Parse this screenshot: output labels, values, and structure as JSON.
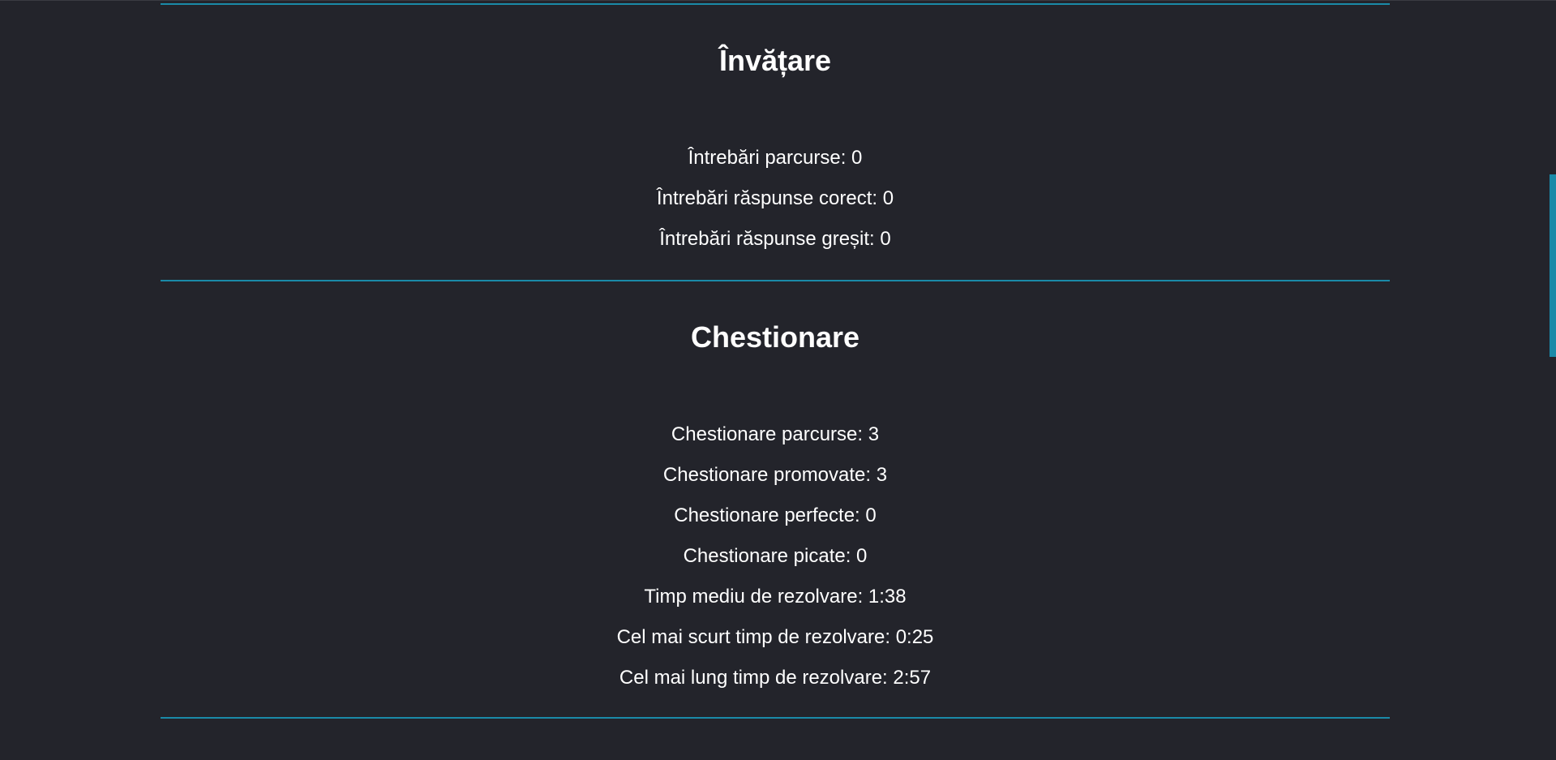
{
  "sections": [
    {
      "title": "Învățare",
      "stats": [
        "Întrebări parcurse: 0",
        "Întrebări răspunse corect: 0",
        "Întrebări răspunse greșit: 0"
      ]
    },
    {
      "title": "Chestionare",
      "stats": [
        "Chestionare parcurse: 3",
        "Chestionare promovate: 3",
        "Chestionare perfecte: 0",
        "Chestionare picate: 0",
        "Timp mediu de rezolvare: 1:38",
        "Cel mai scurt timp de rezolvare: 0:25",
        "Cel mai lung timp de rezolvare: 2:57"
      ]
    }
  ],
  "colors": {
    "background": "#23242b",
    "accent": "#1a8aa8",
    "text": "#ffffff"
  }
}
